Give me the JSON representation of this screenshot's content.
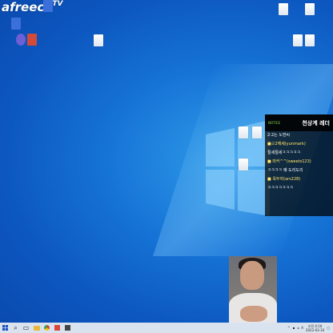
{
  "brand": {
    "text": "afreeca",
    "tv": "TV"
  },
  "desktop_icons": [
    {
      "id": "icon-1",
      "label": "",
      "type": "app",
      "color": "#3b6fd9"
    },
    {
      "id": "icon-2",
      "label": "",
      "type": "app",
      "color": "#e23d3d"
    },
    {
      "id": "icon-3",
      "label": "",
      "type": "app",
      "color": "#6d5fd6"
    },
    {
      "id": "icon-4",
      "label": "",
      "type": "app",
      "color": "#d24a3a"
    },
    {
      "id": "icon-5",
      "label": "",
      "type": "doc"
    },
    {
      "id": "icon-6",
      "label": "",
      "type": "doc"
    },
    {
      "id": "icon-7",
      "label": "",
      "type": "doc"
    },
    {
      "id": "icon-8",
      "label": "",
      "type": "doc"
    },
    {
      "id": "icon-9",
      "label": "",
      "type": "doc"
    },
    {
      "id": "icon-10",
      "label": "",
      "type": "doc"
    },
    {
      "id": "icon-11",
      "label": "",
      "type": "doc"
    },
    {
      "id": "icon-12",
      "label": "",
      "type": "doc"
    }
  ],
  "chat": {
    "notice": "NOTICE",
    "title": "천상계 레더",
    "lines": [
      {
        "user": "",
        "msg": "2:2는 노번씨"
      },
      {
        "user": "■ㄹ2께세(yunmark)",
        "msg": ""
      },
      {
        "user": "",
        "msg": "절세절세ㅋㅋㅋㅋㅋ"
      },
      {
        "user": "■ 마커^^(sweets123)",
        "msg": ""
      },
      {
        "user": "",
        "msg": "ㅋㅋㅋㅋ 왜 도리도리"
      },
      {
        "user": "■ 옥두야(ars228)",
        "msg": ""
      },
      {
        "user": "",
        "msg": "ㅋㅋㅋㅋㅋㅋㅋ"
      }
    ]
  },
  "taskbar": {
    "start_icon": "windows-start-icon",
    "items": [
      "search-icon",
      "task-view-icon",
      "folder-icon",
      "chrome-icon",
      "store-icon",
      "app-icon"
    ],
    "clock_time": "오전 4:16",
    "clock_date": "2022-03-10",
    "tray_icons": [
      "chevron-up-icon",
      "network-icon",
      "volume-icon",
      "notification-icon"
    ],
    "ime": "A"
  }
}
